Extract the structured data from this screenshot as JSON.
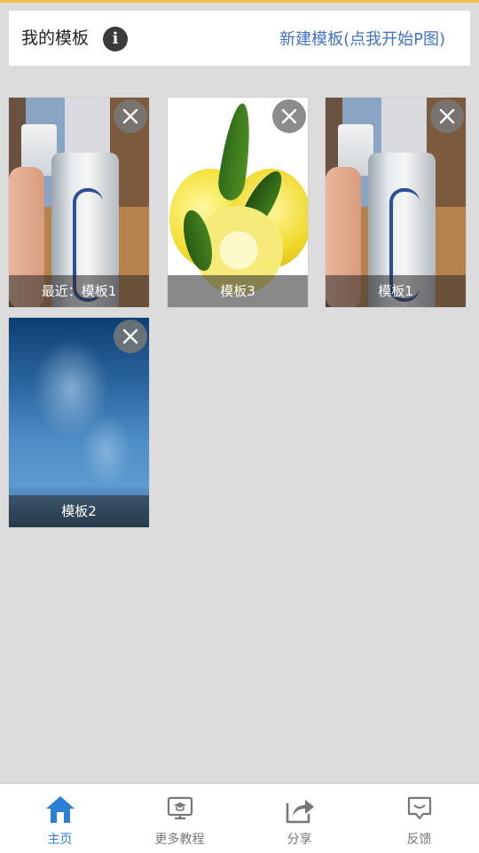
{
  "header": {
    "title": "我的模板",
    "info_icon": "info-icon",
    "new_template_label": "新建模板(点我开始P图)"
  },
  "templates": [
    {
      "caption": "最近：模板1",
      "image": "can-photo"
    },
    {
      "caption": "模板3",
      "image": "lemon-photo"
    },
    {
      "caption": "模板1",
      "image": "can-photo"
    },
    {
      "caption": "模板2",
      "image": "water-photo"
    }
  ],
  "nav": {
    "items": [
      {
        "label": "主页",
        "icon": "home-icon",
        "active": true
      },
      {
        "label": "更多教程",
        "icon": "tutorial-icon",
        "active": false
      },
      {
        "label": "分享",
        "icon": "share-icon",
        "active": false
      },
      {
        "label": "反馈",
        "icon": "feedback-icon",
        "active": false
      }
    ]
  },
  "colors": {
    "accent": "#3f72c8",
    "nav_active": "#2b7fd6",
    "top_line": "#f1c04a",
    "background": "#dcdcdc"
  }
}
